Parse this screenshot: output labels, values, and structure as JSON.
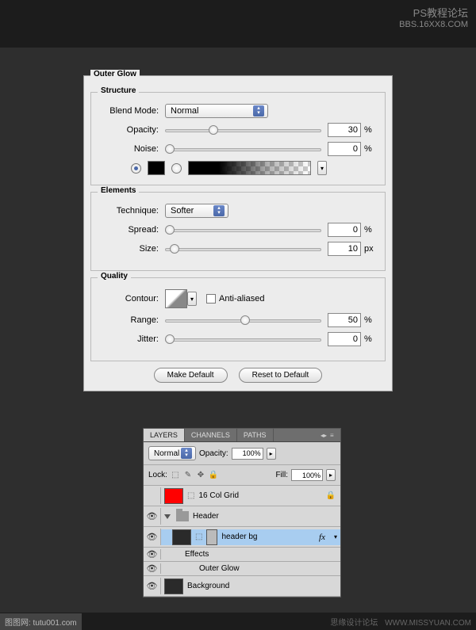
{
  "watermark": {
    "line1": "PS教程论坛",
    "line2": "BBS.16XX8.COM"
  },
  "footer": {
    "left": "图图网: tutu001.com",
    "right1": "思缘设计论坛",
    "right2": "WWW.MISSYUAN.COM"
  },
  "dialog": {
    "title": "Outer Glow",
    "structure": {
      "legend": "Structure",
      "blend_mode_label": "Blend Mode:",
      "blend_mode_value": "Normal",
      "opacity_label": "Opacity:",
      "opacity_value": "30",
      "opacity_unit": "%",
      "noise_label": "Noise:",
      "noise_value": "0",
      "noise_unit": "%"
    },
    "elements": {
      "legend": "Elements",
      "technique_label": "Technique:",
      "technique_value": "Softer",
      "spread_label": "Spread:",
      "spread_value": "0",
      "spread_unit": "%",
      "size_label": "Size:",
      "size_value": "10",
      "size_unit": "px"
    },
    "quality": {
      "legend": "Quality",
      "contour_label": "Contour:",
      "antialiased_label": "Anti-aliased",
      "range_label": "Range:",
      "range_value": "50",
      "range_unit": "%",
      "jitter_label": "Jitter:",
      "jitter_value": "0",
      "jitter_unit": "%"
    },
    "buttons": {
      "make_default": "Make Default",
      "reset": "Reset to Default"
    }
  },
  "layers_panel": {
    "tabs": {
      "layers": "LAYERS",
      "channels": "CHANNELS",
      "paths": "PATHS"
    },
    "blend_mode": "Normal",
    "opacity_label": "Opacity:",
    "opacity_value": "100%",
    "lock_label": "Lock:",
    "fill_label": "Fill:",
    "fill_value": "100%",
    "items": {
      "grid": "16 Col Grid",
      "header": "Header",
      "header_bg": "header bg",
      "effects": "Effects",
      "outer_glow": "Outer Glow",
      "background": "Background"
    },
    "fx": "fx"
  }
}
